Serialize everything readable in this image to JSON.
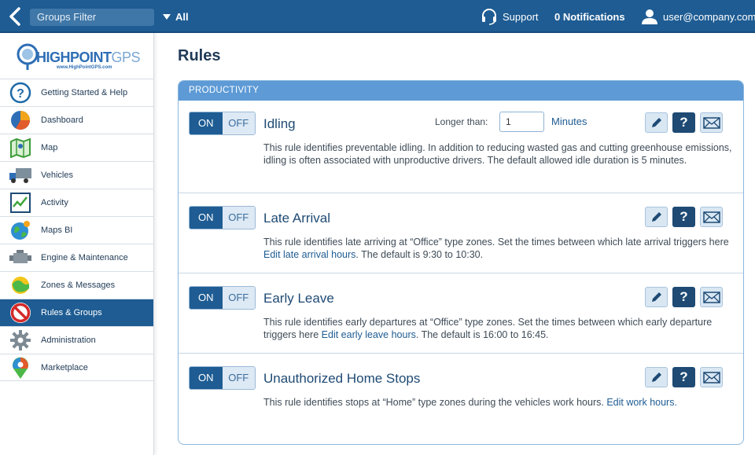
{
  "topbar": {
    "groups_filter_placeholder": "Groups Filter",
    "group_selected": "All",
    "support_label": "Support",
    "notifications_label": "0 Notifications",
    "user_label": "user@company.com"
  },
  "brand": {
    "logo_text_bold": "HIGHPOINT",
    "logo_text_light": "GPS",
    "logo_sub": "www.HighPointGPS.com"
  },
  "sidebar": {
    "items": [
      {
        "label": "Getting Started & Help",
        "icon": "help-icon"
      },
      {
        "label": "Dashboard",
        "icon": "pie-chart-icon"
      },
      {
        "label": "Map",
        "icon": "map-icon"
      },
      {
        "label": "Vehicles",
        "icon": "truck-icon"
      },
      {
        "label": "Activity",
        "icon": "activity-chart-icon"
      },
      {
        "label": "Maps BI",
        "icon": "globe-icon"
      },
      {
        "label": "Engine & Maintenance",
        "icon": "engine-icon"
      },
      {
        "label": "Zones & Messages",
        "icon": "zones-icon"
      },
      {
        "label": "Rules & Groups",
        "icon": "no-sign-icon",
        "active": true
      },
      {
        "label": "Administration",
        "icon": "gear-icon"
      },
      {
        "label": "Marketplace",
        "icon": "map-pin-icon"
      }
    ]
  },
  "main": {
    "title": "Rules",
    "section_label": "PRODUCTIVITY",
    "toggle_on_label": "ON",
    "toggle_off_label": "OFF",
    "rules": [
      {
        "title": "Idling",
        "state": "ON",
        "longer_than_label": "Longer than:",
        "minutes_value": "1",
        "minutes_label": "Minutes",
        "description": "This rule identifies preventable idling. In addition to reducing wasted gas and cutting greenhouse emissions, idling is often associated with unproductive drivers. The default allowed idle duration is 5 minutes."
      },
      {
        "title": "Late Arrival",
        "state": "ON",
        "desc_before": "This rule identifies late arriving at “Office” type zones. Set the times between which late arrival triggers here ",
        "desc_link": "Edit late arrival hours",
        "desc_after": ". The default is 9:30 to 10:30."
      },
      {
        "title": "Early Leave",
        "state": "ON",
        "desc_before": "This rule identifies early departures at “Office” type zones. Set the times between which early departure triggers here ",
        "desc_link": "Edit early leave hours",
        "desc_after": ". The default is 16:00 to 16:45."
      },
      {
        "title": "Unauthorized Home Stops",
        "state": "ON",
        "desc_before": "This rule identifies stops at “Home” type zones during the vehicles work hours. ",
        "desc_link": "Edit work hours.",
        "desc_after": ""
      }
    ],
    "help_glyph": "?"
  },
  "colors": {
    "topbar": "#1e5c93",
    "section_header": "#5d9ad6",
    "active_nav": "#1e5c93",
    "link": "#1e5c93"
  }
}
